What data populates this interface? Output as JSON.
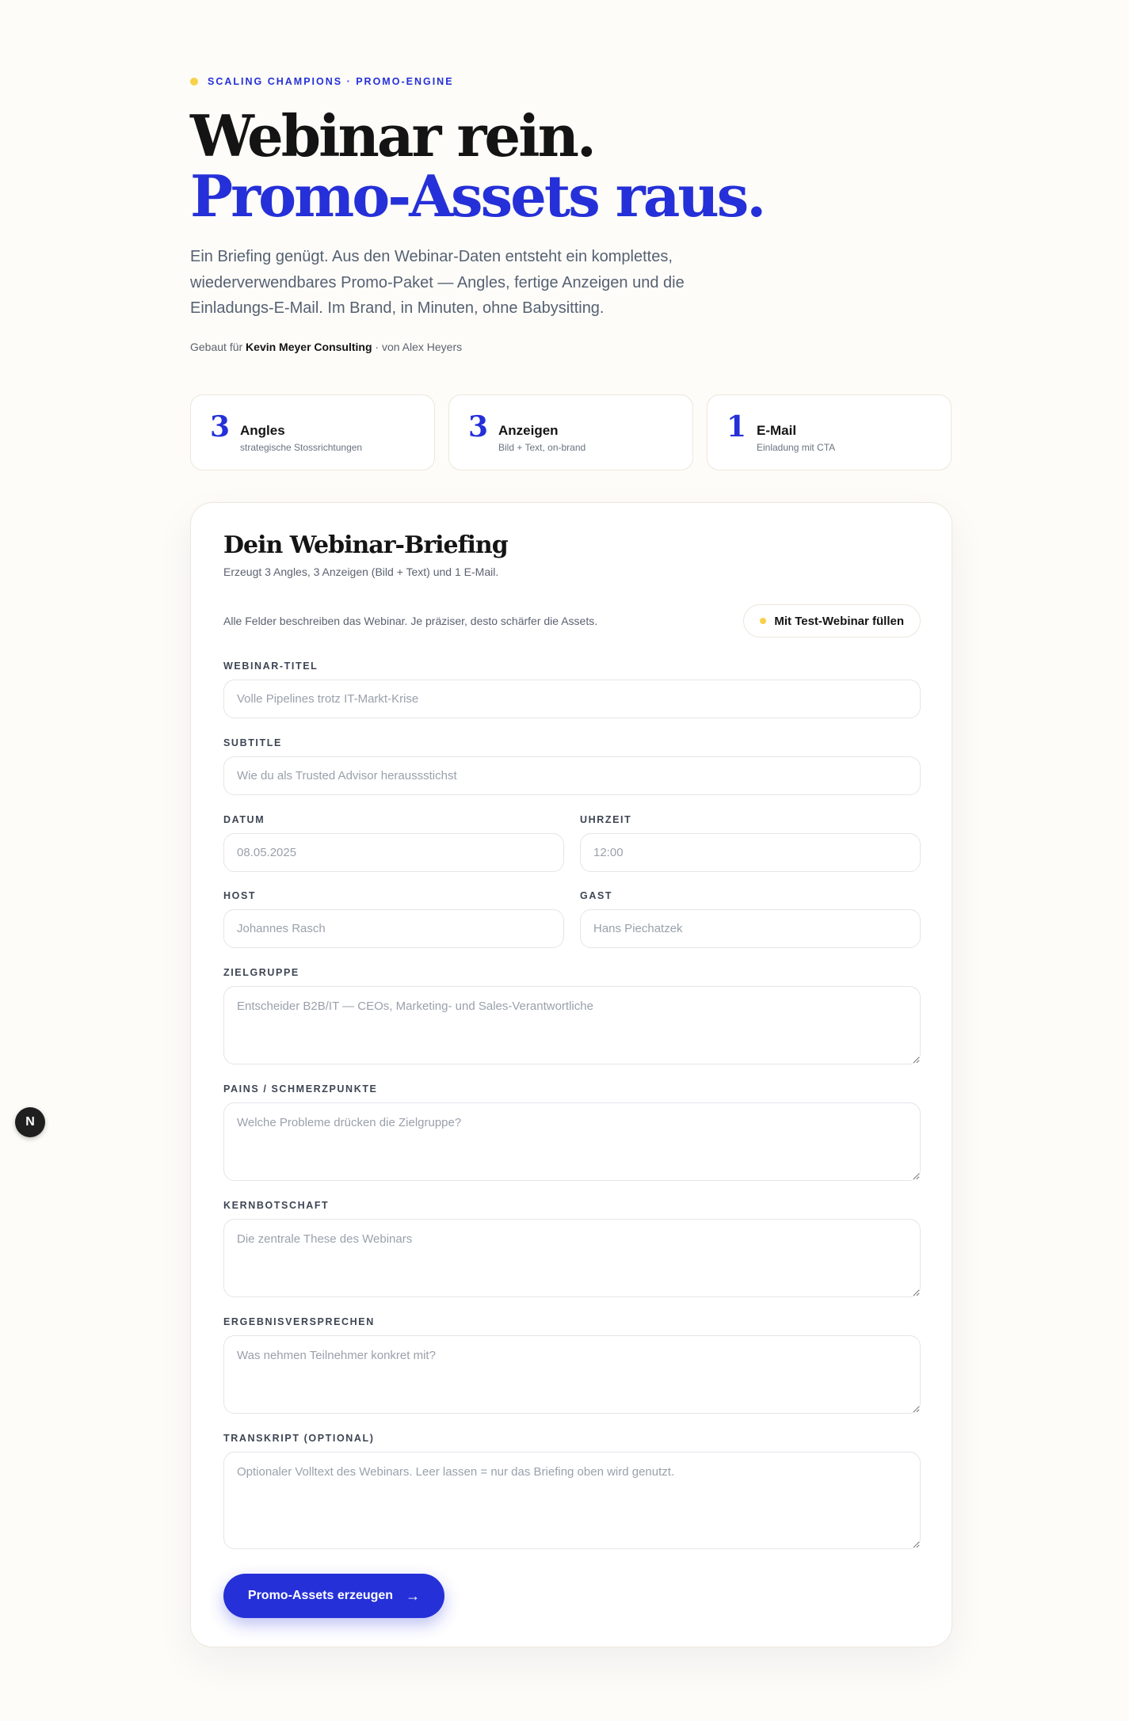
{
  "hero": {
    "eyebrow": "SCALING CHAMPIONS · PROMO-ENGINE",
    "title_line1": "Webinar rein.",
    "title_line2": "Promo-Assets raus.",
    "lead": "Ein Briefing genügt. Aus den Webinar-Daten entsteht ein komplettes, wiederverwendbares Promo-Paket — Angles, fertige Anzeigen und die Einladungs-E-Mail. Im Brand, in Minuten, ohne Babysitting.",
    "byline_prefix": "Gebaut für ",
    "byline_company": "Kevin Meyer Consulting",
    "byline_suffix": " · von Alex Heyers"
  },
  "stats": [
    {
      "num": "3",
      "title": "Angles",
      "desc": "strategische Stossrichtungen"
    },
    {
      "num": "3",
      "title": "Anzeigen",
      "desc": "Bild + Text, on-brand"
    },
    {
      "num": "1",
      "title": "E-Mail",
      "desc": "Einladung mit CTA"
    }
  ],
  "form": {
    "title": "Dein Webinar-Briefing",
    "subtitle": "Erzeugt 3 Angles, 3 Anzeigen (Bild + Text) und 1 E-Mail.",
    "intro": "Alle Felder beschreiben das Webinar. Je präziser, desto schärfer die Assets.",
    "test_button": "Mit Test-Webinar füllen",
    "fields": {
      "title": {
        "label": "WEBINAR-TITEL",
        "placeholder": "Volle Pipelines trotz IT-Markt-Krise"
      },
      "subtitle": {
        "label": "SUBTITLE",
        "placeholder": "Wie du als Trusted Advisor heraussstichst"
      },
      "date": {
        "label": "DATUM",
        "placeholder": "08.05.2025"
      },
      "time": {
        "label": "UHRZEIT",
        "placeholder": "12:00"
      },
      "host": {
        "label": "HOST",
        "placeholder": "Johannes Rasch"
      },
      "guest": {
        "label": "GAST",
        "placeholder": "Hans Piechatzek"
      },
      "audience": {
        "label": "ZIELGRUPPE",
        "placeholder": "Entscheider B2B/IT — CEOs, Marketing- und Sales-Verantwortliche"
      },
      "pains": {
        "label": "PAINS / SCHMERZPUNKTE",
        "placeholder": "Welche Probleme drücken die Zielgruppe?"
      },
      "message": {
        "label": "KERNBOTSCHAFT",
        "placeholder": "Die zentrale These des Webinars"
      },
      "promise": {
        "label": "ERGEBNISVERSPRECHEN",
        "placeholder": "Was nehmen Teilnehmer konkret mit?"
      },
      "transcript": {
        "label": "TRANSKRIPT (OPTIONAL)",
        "placeholder": "Optionaler Volltext des Webinars. Leer lassen = nur das Briefing oben wird genutzt."
      }
    },
    "submit_label": "Promo-Assets erzeugen",
    "submit_icon": "→"
  },
  "badge": {
    "letter": "N"
  },
  "colors": {
    "accent": "#2530d8",
    "highlight": "#f6d24a",
    "background": "#fdfcf8"
  }
}
